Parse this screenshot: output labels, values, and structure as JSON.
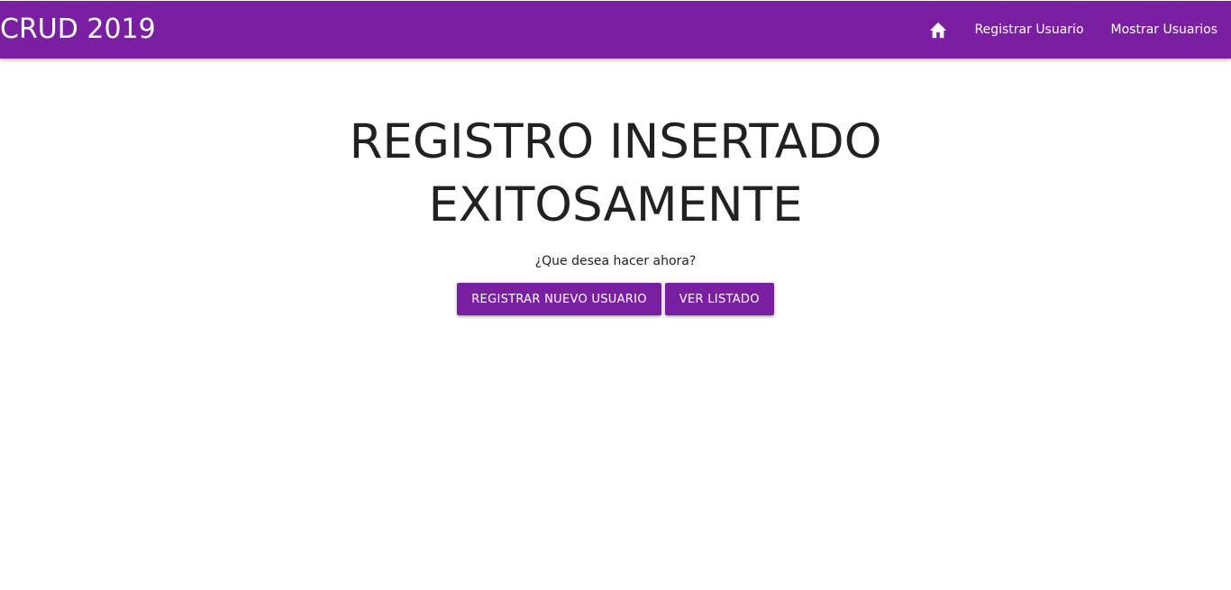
{
  "navbar": {
    "brand": "CRUD 2019",
    "home_icon": "home-icon",
    "links": [
      {
        "label": "Registrar Usuario"
      },
      {
        "label": "Mostrar Usuarios"
      }
    ],
    "background_color": "#7b1fa2"
  },
  "main": {
    "title_line1": "REGISTRO INSERTADO",
    "title_line2": "EXITOSAMENTE",
    "question": "¿Que desea hacer ahora?",
    "buttons": [
      {
        "label": "REGISTRAR NUEVO USUARIO"
      },
      {
        "label": "VER LISTADO"
      }
    ]
  }
}
